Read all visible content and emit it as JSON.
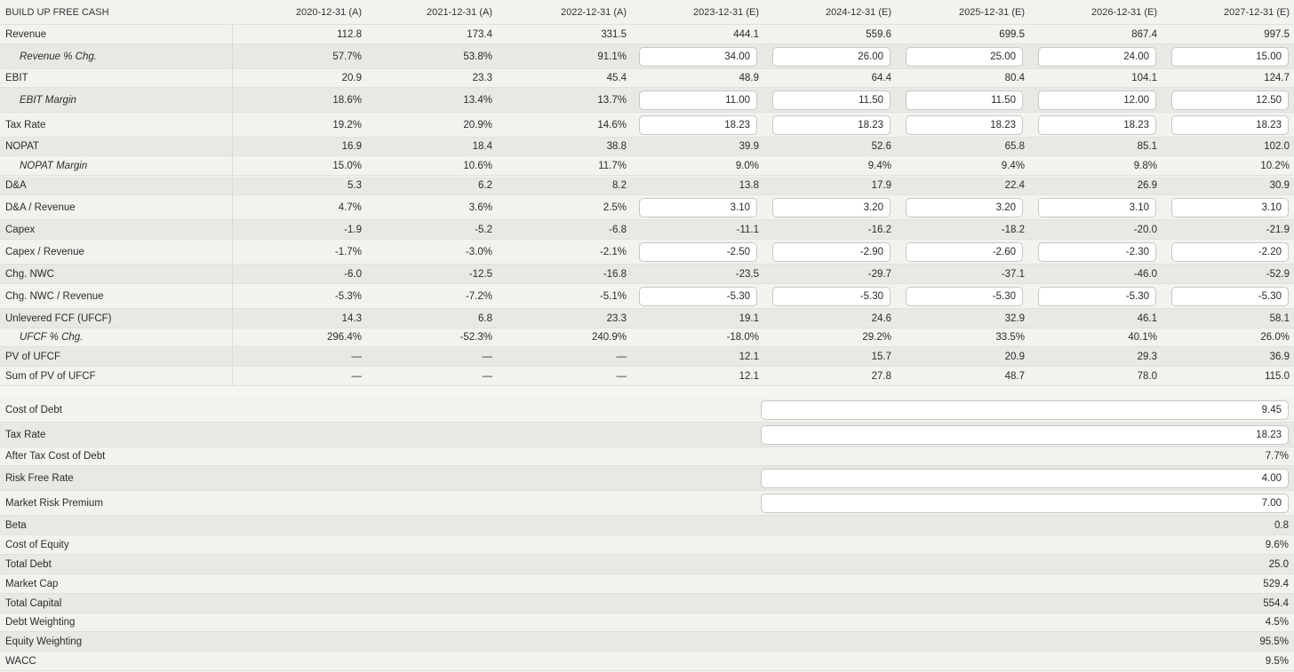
{
  "header": {
    "title": "BUILD UP FREE CASH",
    "years": [
      "2020-12-31 (A)",
      "2021-12-31 (A)",
      "2022-12-31 (A)",
      "2023-12-31 (E)",
      "2024-12-31 (E)",
      "2025-12-31 (E)",
      "2026-12-31 (E)",
      "2027-12-31 (E)"
    ]
  },
  "fcf_rows": [
    {
      "key": "revenue",
      "label": "Revenue",
      "italic": false,
      "values": [
        "112.8",
        "173.4",
        "331.5",
        "444.1",
        "559.6",
        "699.5",
        "867.4",
        "997.5"
      ],
      "inputs": []
    },
    {
      "key": "revenue-pct-chg",
      "label": "Revenue % Chg.",
      "italic": true,
      "values": [
        "57.7%",
        "53.8%",
        "91.1%",
        "34.00",
        "26.00",
        "25.00",
        "24.00",
        "15.00"
      ],
      "inputs": [
        3,
        4,
        5,
        6,
        7
      ]
    },
    {
      "key": "ebit",
      "label": "EBIT",
      "italic": false,
      "values": [
        "20.9",
        "23.3",
        "45.4",
        "48.9",
        "64.4",
        "80.4",
        "104.1",
        "124.7"
      ],
      "inputs": []
    },
    {
      "key": "ebit-margin",
      "label": "EBIT Margin",
      "italic": true,
      "values": [
        "18.6%",
        "13.4%",
        "13.7%",
        "11.00",
        "11.50",
        "11.50",
        "12.00",
        "12.50"
      ],
      "inputs": [
        3,
        4,
        5,
        6,
        7
      ]
    },
    {
      "key": "tax-rate",
      "label": "Tax Rate",
      "italic": false,
      "values": [
        "19.2%",
        "20.9%",
        "14.6%",
        "18.23",
        "18.23",
        "18.23",
        "18.23",
        "18.23"
      ],
      "inputs": [
        3,
        4,
        5,
        6,
        7
      ]
    },
    {
      "key": "nopat",
      "label": "NOPAT",
      "italic": false,
      "values": [
        "16.9",
        "18.4",
        "38.8",
        "39.9",
        "52.6",
        "65.8",
        "85.1",
        "102.0"
      ],
      "inputs": []
    },
    {
      "key": "nopat-margin",
      "label": "NOPAT Margin",
      "italic": true,
      "values": [
        "15.0%",
        "10.6%",
        "11.7%",
        "9.0%",
        "9.4%",
        "9.4%",
        "9.8%",
        "10.2%"
      ],
      "inputs": []
    },
    {
      "key": "da",
      "label": "D&A",
      "italic": false,
      "values": [
        "5.3",
        "6.2",
        "8.2",
        "13.8",
        "17.9",
        "22.4",
        "26.9",
        "30.9"
      ],
      "inputs": []
    },
    {
      "key": "da-revenue",
      "label": "D&A / Revenue",
      "italic": false,
      "values": [
        "4.7%",
        "3.6%",
        "2.5%",
        "3.10",
        "3.20",
        "3.20",
        "3.10",
        "3.10"
      ],
      "inputs": [
        3,
        4,
        5,
        6,
        7
      ]
    },
    {
      "key": "capex",
      "label": "Capex",
      "italic": false,
      "values": [
        "-1.9",
        "-5.2",
        "-6.8",
        "-11.1",
        "-16.2",
        "-18.2",
        "-20.0",
        "-21.9"
      ],
      "inputs": []
    },
    {
      "key": "capex-revenue",
      "label": "Capex / Revenue",
      "italic": false,
      "values": [
        "-1.7%",
        "-3.0%",
        "-2.1%",
        "-2.50",
        "-2.90",
        "-2.60",
        "-2.30",
        "-2.20"
      ],
      "inputs": [
        3,
        4,
        5,
        6,
        7
      ]
    },
    {
      "key": "chg-nwc",
      "label": "Chg. NWC",
      "italic": false,
      "values": [
        "-6.0",
        "-12.5",
        "-16.8",
        "-23.5",
        "-29.7",
        "-37.1",
        "-46.0",
        "-52.9"
      ],
      "inputs": []
    },
    {
      "key": "chg-nwc-revenue",
      "label": "Chg. NWC / Revenue",
      "italic": false,
      "values": [
        "-5.3%",
        "-7.2%",
        "-5.1%",
        "-5.30",
        "-5.30",
        "-5.30",
        "-5.30",
        "-5.30"
      ],
      "inputs": [
        3,
        4,
        5,
        6,
        7
      ]
    },
    {
      "key": "ufcf",
      "label": "Unlevered FCF (UFCF)",
      "italic": false,
      "values": [
        "14.3",
        "6.8",
        "23.3",
        "19.1",
        "24.6",
        "32.9",
        "46.1",
        "58.1"
      ],
      "inputs": []
    },
    {
      "key": "ufcf-pct-chg",
      "label": "UFCF % Chg.",
      "italic": true,
      "values": [
        "296.4%",
        "-52.3%",
        "240.9%",
        "-18.0%",
        "29.2%",
        "33.5%",
        "40.1%",
        "26.0%"
      ],
      "inputs": []
    },
    {
      "key": "pv-ufcf",
      "label": "PV of UFCF",
      "italic": false,
      "values": [
        "—",
        "—",
        "—",
        "12.1",
        "15.7",
        "20.9",
        "29.3",
        "36.9"
      ],
      "inputs": []
    },
    {
      "key": "sum-pv-ufcf",
      "label": "Sum of PV of UFCF",
      "italic": false,
      "values": [
        "—",
        "—",
        "—",
        "12.1",
        "27.8",
        "48.7",
        "78.0",
        "115.0"
      ],
      "inputs": []
    }
  ],
  "wacc_rows": [
    {
      "key": "cost-of-debt",
      "label": "Cost of Debt",
      "value": "9.45",
      "input": true
    },
    {
      "key": "tax-rate",
      "label": "Tax Rate",
      "value": "18.23",
      "input": true
    },
    {
      "key": "after-tax-cost-of-debt",
      "label": "After Tax Cost of Debt",
      "value": "7.7%",
      "input": false
    },
    {
      "key": "risk-free-rate",
      "label": "Risk Free Rate",
      "value": "4.00",
      "input": true
    },
    {
      "key": "market-risk-premium",
      "label": "Market Risk Premium",
      "value": "7.00",
      "input": true
    },
    {
      "key": "beta",
      "label": "Beta",
      "value": "0.8",
      "input": false
    },
    {
      "key": "cost-of-equity",
      "label": "Cost of Equity",
      "value": "9.6%",
      "input": false
    },
    {
      "key": "total-debt",
      "label": "Total Debt",
      "value": "25.0",
      "input": false
    },
    {
      "key": "market-cap",
      "label": "Market Cap",
      "value": "529.4",
      "input": false
    },
    {
      "key": "total-capital",
      "label": "Total Capital",
      "value": "554.4",
      "input": false
    },
    {
      "key": "debt-weighting",
      "label": "Debt Weighting",
      "value": "4.5%",
      "input": false
    },
    {
      "key": "equity-weighting",
      "label": "Equity Weighting",
      "value": "95.5%",
      "input": false
    },
    {
      "key": "wacc",
      "label": "WACC",
      "value": "9.5%",
      "input": false
    }
  ]
}
